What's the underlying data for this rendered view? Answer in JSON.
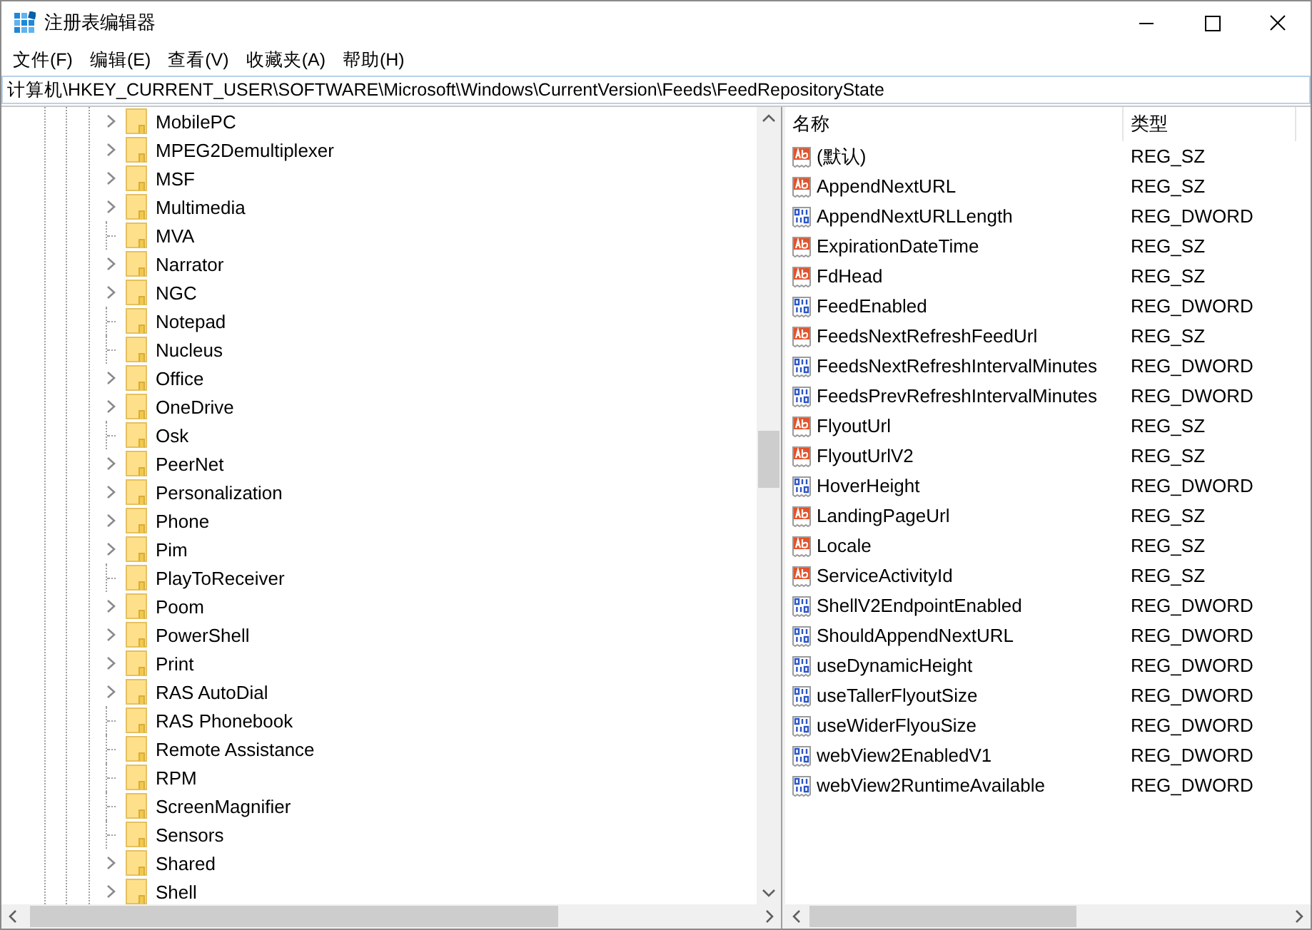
{
  "window": {
    "title": "注册表编辑器",
    "controls": [
      {
        "kind": "minimize"
      },
      {
        "kind": "maximize"
      },
      {
        "kind": "close"
      }
    ]
  },
  "menu": [
    "文件(F)",
    "编辑(E)",
    "查看(V)",
    "收藏夹(A)",
    "帮助(H)"
  ],
  "address": "计算机\\HKEY_CURRENT_USER\\SOFTWARE\\Microsoft\\Windows\\CurrentVersion\\Feeds\\FeedRepositoryState",
  "tree": [
    {
      "label": "MobilePC",
      "expandable": true
    },
    {
      "label": "MPEG2Demultiplexer",
      "expandable": true
    },
    {
      "label": "MSF",
      "expandable": true
    },
    {
      "label": "Multimedia",
      "expandable": true
    },
    {
      "label": "MVA",
      "expandable": false
    },
    {
      "label": "Narrator",
      "expandable": true
    },
    {
      "label": "NGC",
      "expandable": true
    },
    {
      "label": "Notepad",
      "expandable": false
    },
    {
      "label": "Nucleus",
      "expandable": false
    },
    {
      "label": "Office",
      "expandable": true
    },
    {
      "label": "OneDrive",
      "expandable": true
    },
    {
      "label": "Osk",
      "expandable": false
    },
    {
      "label": "PeerNet",
      "expandable": true
    },
    {
      "label": "Personalization",
      "expandable": true
    },
    {
      "label": "Phone",
      "expandable": true
    },
    {
      "label": "Pim",
      "expandable": true
    },
    {
      "label": "PlayToReceiver",
      "expandable": false
    },
    {
      "label": "Poom",
      "expandable": true
    },
    {
      "label": "PowerShell",
      "expandable": true
    },
    {
      "label": "Print",
      "expandable": true
    },
    {
      "label": "RAS AutoDial",
      "expandable": true
    },
    {
      "label": "RAS Phonebook",
      "expandable": false
    },
    {
      "label": "Remote Assistance",
      "expandable": false
    },
    {
      "label": "RPM",
      "expandable": false
    },
    {
      "label": "ScreenMagnifier",
      "expandable": false
    },
    {
      "label": "Sensors",
      "expandable": false
    },
    {
      "label": "Shared",
      "expandable": true
    },
    {
      "label": "Shell",
      "expandable": true
    }
  ],
  "values": {
    "columns": [
      "名称",
      "类型"
    ],
    "rows": [
      {
        "kind": "sz",
        "name": "(默认)",
        "type": "REG_SZ"
      },
      {
        "kind": "sz",
        "name": "AppendNextURL",
        "type": "REG_SZ"
      },
      {
        "kind": "dword",
        "name": "AppendNextURLLength",
        "type": "REG_DWORD"
      },
      {
        "kind": "sz",
        "name": "ExpirationDateTime",
        "type": "REG_SZ"
      },
      {
        "kind": "sz",
        "name": "FdHead",
        "type": "REG_SZ"
      },
      {
        "kind": "dword",
        "name": "FeedEnabled",
        "type": "REG_DWORD"
      },
      {
        "kind": "sz",
        "name": "FeedsNextRefreshFeedUrl",
        "type": "REG_SZ"
      },
      {
        "kind": "dword",
        "name": "FeedsNextRefreshIntervalMinutes",
        "type": "REG_DWORD"
      },
      {
        "kind": "dword",
        "name": "FeedsPrevRefreshIntervalMinutes",
        "type": "REG_DWORD"
      },
      {
        "kind": "sz",
        "name": "FlyoutUrl",
        "type": "REG_SZ"
      },
      {
        "kind": "sz",
        "name": "FlyoutUrlV2",
        "type": "REG_SZ"
      },
      {
        "kind": "dword",
        "name": "HoverHeight",
        "type": "REG_DWORD"
      },
      {
        "kind": "sz",
        "name": "LandingPageUrl",
        "type": "REG_SZ"
      },
      {
        "kind": "sz",
        "name": "Locale",
        "type": "REG_SZ"
      },
      {
        "kind": "sz",
        "name": "ServiceActivityId",
        "type": "REG_SZ"
      },
      {
        "kind": "dword",
        "name": "ShellV2EndpointEnabled",
        "type": "REG_DWORD"
      },
      {
        "kind": "dword",
        "name": "ShouldAppendNextURL",
        "type": "REG_DWORD"
      },
      {
        "kind": "dword",
        "name": "useDynamicHeight",
        "type": "REG_DWORD"
      },
      {
        "kind": "dword",
        "name": "useTallerFlyoutSize",
        "type": "REG_DWORD"
      },
      {
        "kind": "dword",
        "name": "useWiderFlyouSize",
        "type": "REG_DWORD"
      },
      {
        "kind": "dword",
        "name": "webView2EnabledV1",
        "type": "REG_DWORD"
      },
      {
        "kind": "dword",
        "name": "webView2RuntimeAvailable",
        "type": "REG_DWORD"
      }
    ]
  }
}
